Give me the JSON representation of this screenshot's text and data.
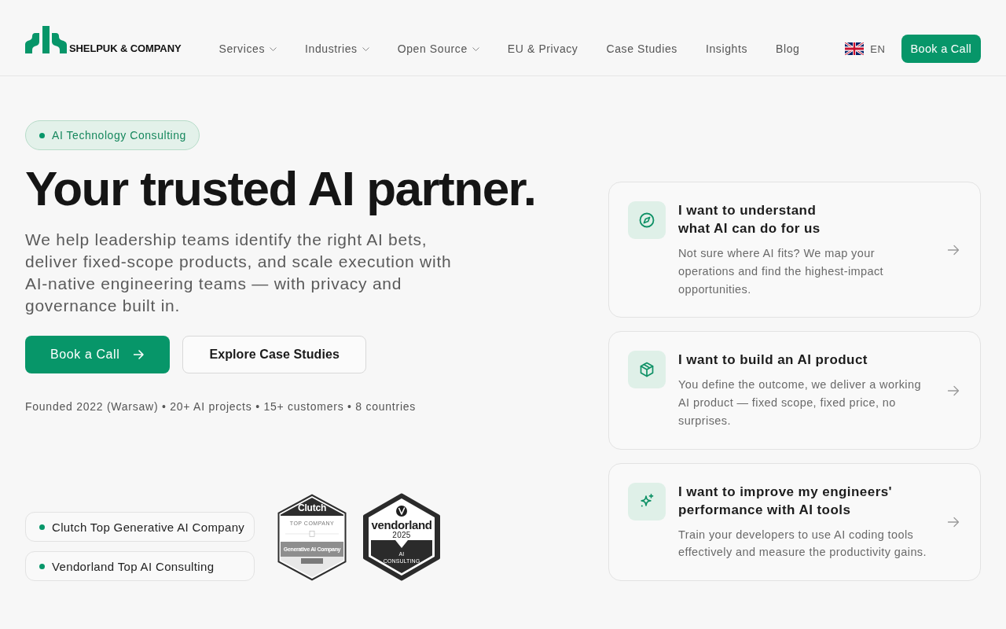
{
  "header": {
    "logo": "SHELPUK & COMPANY",
    "nav": [
      {
        "label": "Services",
        "has_menu": true
      },
      {
        "label": "Industries",
        "has_menu": true
      },
      {
        "label": "Open Source",
        "has_menu": true
      },
      {
        "label": "EU & Privacy",
        "has_menu": false
      },
      {
        "label": "Case Studies",
        "has_menu": false
      },
      {
        "label": "Insights",
        "has_menu": false
      },
      {
        "label": "Blog",
        "has_menu": false
      }
    ],
    "language": "EN",
    "cta": "Book a Call"
  },
  "hero": {
    "tag": "AI Technology Consulting",
    "title": "Your trusted AI partner.",
    "description": "We help leadership teams identify the right AI bets, deliver fixed-scope products, and scale execution with AI-native engineering teams — with privacy and governance built in.",
    "buttons": [
      {
        "label": "Book a Call",
        "kind": "primary"
      },
      {
        "label": "Explore Case Studies",
        "kind": "secondary"
      }
    ],
    "facts": "Founded 2022 (Warsaw) • 20+ AI projects • 15+ customers • 8 countries",
    "awards": [
      "Clutch Top Generative AI Company",
      "Vendorland Top AI Consulting"
    ],
    "badges": [
      {
        "kind": "clutch",
        "brand": "Clutch",
        "caption": "TOP COMPANY",
        "category": "Generative AI Company"
      },
      {
        "kind": "vendorland",
        "brand": "vendorland",
        "year": "2025",
        "category": "AI CONSULTING"
      }
    ]
  },
  "options": [
    {
      "title": "I want to understand\nwhat AI can do for us",
      "description": "Not sure where AI fits? We map your operations and find the highest-impact opportunities."
    },
    {
      "title": "I want to build an AI product",
      "description": "You define the outcome, we deliver a working AI product — fixed scope, fixed price, no surprises."
    },
    {
      "title": "I want to improve my engineers' performance with AI tools",
      "description": "Train your developers to use AI coding tools effectively and measure the productivity gains."
    }
  ]
}
